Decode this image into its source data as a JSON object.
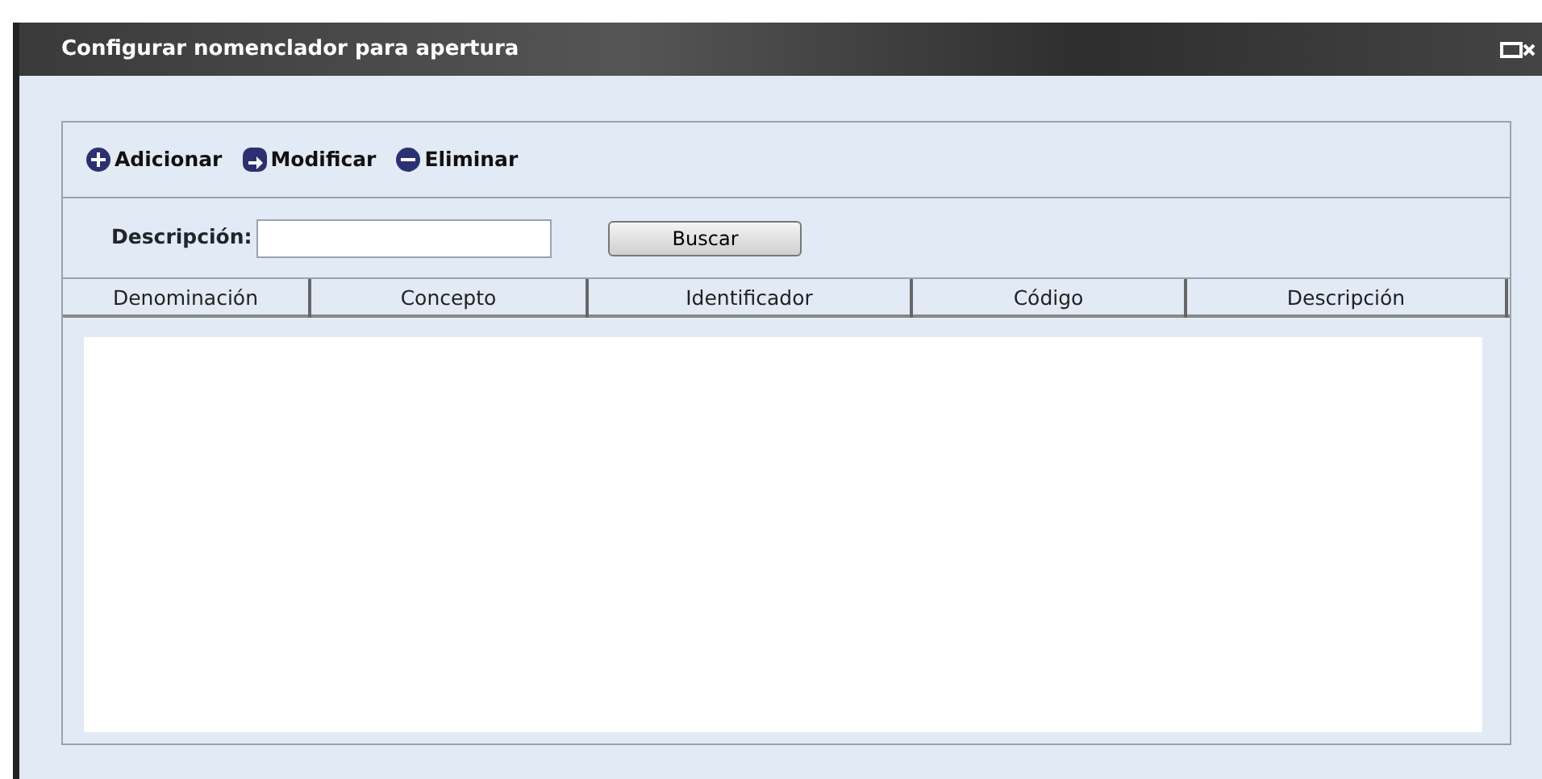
{
  "window": {
    "title": "Configurar nomenclador para apertura"
  },
  "toolbar": [
    {
      "kind": "add",
      "label": "Adicionar"
    },
    {
      "kind": "edit",
      "label": "Modificar"
    },
    {
      "kind": "remove",
      "label": "Eliminar"
    }
  ],
  "search": {
    "label": "Descripción:",
    "button": "Buscar"
  },
  "table": {
    "columns": [
      "Denominación",
      "Concepto",
      "Identificador",
      "Código",
      "Descripción"
    ]
  }
}
